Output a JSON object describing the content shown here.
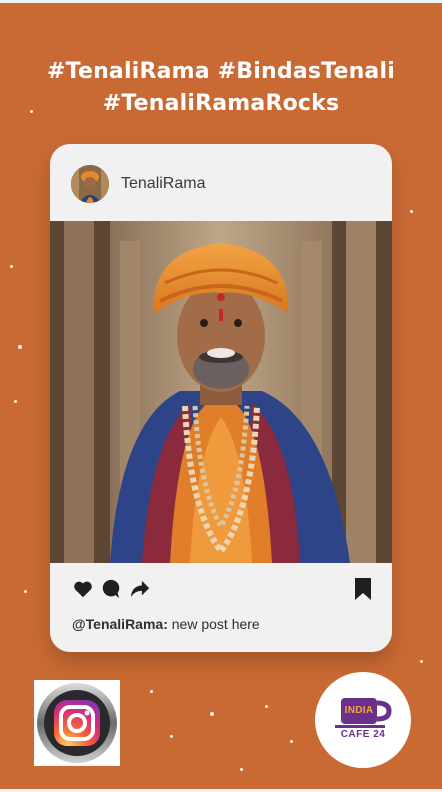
{
  "header": {
    "hashtag_line1": "#TenaliRama #BindasTenali",
    "hashtag_line2": "#TenaliRamaRocks"
  },
  "post": {
    "username": "TenaliRama",
    "caption_handle": "@TenaliRama:",
    "caption_text": " new post here",
    "photo_icon": "portrait-photo",
    "actions": [
      "heart-icon",
      "comment-icon",
      "share-icon",
      "bookmark-icon"
    ]
  },
  "badges": {
    "instagram_icon": "instagram-logo",
    "cafe_line1": "INDIA",
    "cafe_line2": "CAFE 24"
  },
  "colors": {
    "background": "#c96a34",
    "card": "#f1f1f1",
    "cafe_purple": "#6b2f8c"
  }
}
